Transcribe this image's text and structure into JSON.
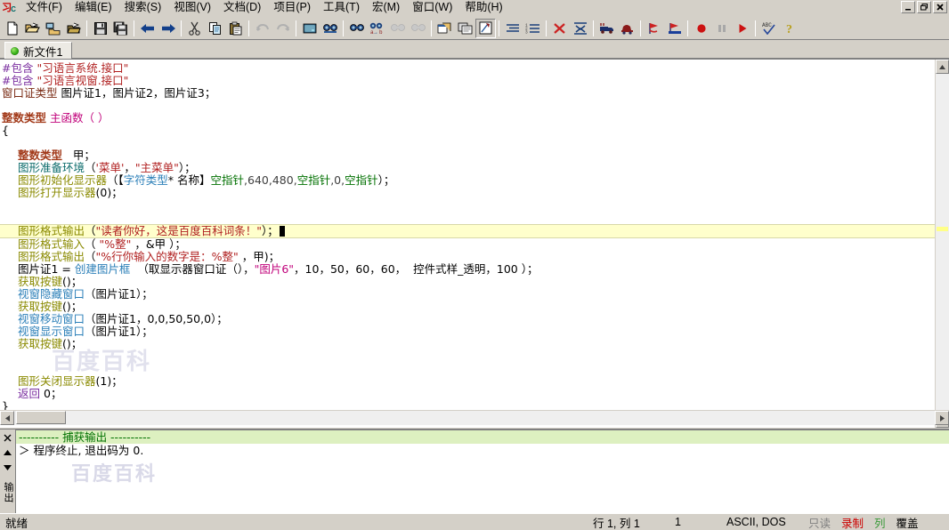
{
  "window": {
    "controls": [
      {
        "name": "minimize",
        "glyph": "minimize-icon"
      },
      {
        "name": "restore",
        "glyph": "restore-icon"
      },
      {
        "name": "close",
        "glyph": "close-icon"
      }
    ]
  },
  "menubar": {
    "app_icon": "xi-language-icon",
    "items": [
      {
        "label": "文件(F)",
        "name": "menu-file"
      },
      {
        "label": "编辑(E)",
        "name": "menu-edit"
      },
      {
        "label": "搜索(S)",
        "name": "menu-search"
      },
      {
        "label": "视图(V)",
        "name": "menu-view"
      },
      {
        "label": "文档(D)",
        "name": "menu-document"
      },
      {
        "label": "项目(P)",
        "name": "menu-project"
      },
      {
        "label": "工具(T)",
        "name": "menu-tools"
      },
      {
        "label": "宏(M)",
        "name": "menu-macro"
      },
      {
        "label": "窗口(W)",
        "name": "menu-window"
      },
      {
        "label": "帮助(H)",
        "name": "menu-help"
      }
    ]
  },
  "toolbar": {
    "buttons": [
      {
        "name": "new-file-icon",
        "enabled": true
      },
      {
        "name": "open-file-icon",
        "enabled": true
      },
      {
        "name": "open-network-file-icon",
        "enabled": true
      },
      {
        "name": "open-project-icon",
        "enabled": true
      },
      {
        "sep": true
      },
      {
        "name": "save-icon",
        "enabled": true
      },
      {
        "name": "save-all-icon",
        "enabled": true
      },
      {
        "sep": true
      },
      {
        "name": "back-arrow-icon",
        "enabled": true
      },
      {
        "name": "forward-arrow-icon",
        "enabled": true
      },
      {
        "sep": true
      },
      {
        "name": "cut-icon",
        "enabled": true
      },
      {
        "name": "copy-icon",
        "enabled": true
      },
      {
        "name": "paste-icon",
        "enabled": true
      },
      {
        "sep": true
      },
      {
        "name": "undo-icon",
        "enabled": false
      },
      {
        "name": "redo-icon",
        "enabled": false
      },
      {
        "sep": true
      },
      {
        "name": "print-preview-icon",
        "enabled": true
      },
      {
        "name": "find-icon",
        "enabled": true
      },
      {
        "sep": true
      },
      {
        "name": "find-next-icon",
        "enabled": true
      },
      {
        "name": "replace-icon",
        "enabled": true
      },
      {
        "name": "find-in-files-icon",
        "enabled": false
      },
      {
        "name": "find-previous-icon",
        "enabled": false
      },
      {
        "sep": true
      },
      {
        "name": "window-tile-icon",
        "enabled": true
      },
      {
        "name": "window-cascade-icon",
        "enabled": true
      },
      {
        "name": "run-macro-icon",
        "enabled": true,
        "pressed": true
      },
      {
        "sep": true
      },
      {
        "name": "indent-lines-icon",
        "enabled": true
      },
      {
        "name": "line-numbers-icon",
        "enabled": true
      },
      {
        "sep": true
      },
      {
        "name": "delete-icon",
        "enabled": true
      },
      {
        "name": "collapse-icon",
        "enabled": true
      },
      {
        "sep": true
      },
      {
        "name": "compile-icon",
        "enabled": true
      },
      {
        "name": "build-icon",
        "enabled": true
      },
      {
        "sep": true
      },
      {
        "name": "debug-icon",
        "enabled": true
      },
      {
        "name": "debug-run-icon",
        "enabled": true
      },
      {
        "sep": true
      },
      {
        "name": "record-icon",
        "enabled": true
      },
      {
        "name": "pause-icon",
        "enabled": false
      },
      {
        "name": "run-icon",
        "enabled": true
      },
      {
        "sep": true
      },
      {
        "name": "spell-check-icon",
        "enabled": true
      },
      {
        "name": "help-icon",
        "enabled": true
      }
    ]
  },
  "tabs": [
    {
      "label": "新文件1",
      "name": "tab-new-file-1",
      "active": true,
      "dot": "green-dot-icon"
    }
  ],
  "editor": {
    "watermark_big": "百度百科",
    "watermark_small": "百度百科",
    "lines": [
      {
        "indent": 0,
        "tokens": [
          {
            "t": "#包含 ",
            "c": "c-pre"
          },
          {
            "t": "\"习语言系统.接口\"",
            "c": "c-str"
          }
        ]
      },
      {
        "indent": 0,
        "tokens": [
          {
            "t": "#包含 ",
            "c": "c-pre"
          },
          {
            "t": "\"习语言视窗.接口\"",
            "c": "c-str"
          }
        ]
      },
      {
        "indent": 0,
        "tokens": [
          {
            "t": "窗口证类型",
            "c": "c-type"
          },
          {
            "t": " 图片证1，图片证2，图片证3；",
            "c": "c-plain"
          }
        ]
      },
      {
        "indent": 0,
        "tokens": []
      },
      {
        "indent": 0,
        "tokens": [
          {
            "t": "整数类型",
            "c": "c-kw"
          },
          {
            "t": " 主函数（ ）",
            "c": "c-pink"
          }
        ]
      },
      {
        "indent": 0,
        "tokens": [
          {
            "t": "{",
            "c": "c-plain"
          }
        ]
      },
      {
        "indent": 0,
        "tokens": []
      },
      {
        "indent": 2,
        "tokens": [
          {
            "t": "整数类型",
            "c": "c-kw"
          },
          {
            "t": "   甲；",
            "c": "c-plain"
          }
        ]
      },
      {
        "indent": 2,
        "tokens": [
          {
            "t": "图形准备环境",
            "c": "c-fn"
          },
          {
            "t": "（",
            "c": "c-plain"
          },
          {
            "t": "'菜单'",
            "c": "c-str"
          },
          {
            "t": "，",
            "c": "c-plain"
          },
          {
            "t": "\"主菜单\"",
            "c": "c-str"
          },
          {
            "t": "）；",
            "c": "c-plain"
          }
        ]
      },
      {
        "indent": 2,
        "tokens": [
          {
            "t": "图形初始化显示器",
            "c": "c-olive"
          },
          {
            "t": "（【",
            "c": "c-plain"
          },
          {
            "t": "字符类型",
            "c": "c-fn3"
          },
          {
            "t": "* 名称】",
            "c": "c-plain"
          },
          {
            "t": "空指针",
            "c": "c-green"
          },
          {
            "t": ",640,480,",
            "c": "c-num"
          },
          {
            "t": "空指针",
            "c": "c-green"
          },
          {
            "t": ",0,",
            "c": "c-num"
          },
          {
            "t": "空指针",
            "c": "c-green"
          },
          {
            "t": "）；",
            "c": "c-plain"
          }
        ]
      },
      {
        "indent": 2,
        "tokens": [
          {
            "t": "图形打开显示器",
            "c": "c-olive"
          },
          {
            "t": "(0)；",
            "c": "c-plain"
          }
        ]
      },
      {
        "indent": 0,
        "tokens": []
      },
      {
        "indent": 0,
        "tokens": []
      },
      {
        "indent": 2,
        "highlight": true,
        "tokens": [
          {
            "t": "图形格式输出",
            "c": "c-olive"
          },
          {
            "t": "（",
            "c": "c-plain"
          },
          {
            "t": "\"读者你好，这是百度百科词条！\"",
            "c": "c-str"
          },
          {
            "t": "）；",
            "c": "c-plain"
          }
        ],
        "caret": true
      },
      {
        "indent": 2,
        "tokens": [
          {
            "t": "图形格式输入",
            "c": "c-olive"
          },
          {
            "t": "（ ",
            "c": "c-plain"
          },
          {
            "t": "\"%整\"",
            "c": "c-str"
          },
          {
            "t": " ，&甲 ）；",
            "c": "c-plain"
          }
        ]
      },
      {
        "indent": 2,
        "tokens": [
          {
            "t": "图形格式输出",
            "c": "c-olive"
          },
          {
            "t": "（",
            "c": "c-plain"
          },
          {
            "t": "\"%行你输入的数字是：%整\"",
            "c": "c-str"
          },
          {
            "t": " ，甲)；",
            "c": "c-plain"
          }
        ]
      },
      {
        "indent": 2,
        "tokens": [
          {
            "t": "图片证1 = ",
            "c": "c-plain"
          },
          {
            "t": "创建图片框",
            "c": "c-fn3"
          },
          {
            "t": "  （取显示器窗口证（），",
            "c": "c-plain"
          },
          {
            "t": "\"图片6\"",
            "c": "c-pink"
          },
          {
            "t": "，10，50，60，60，  控件式样_透明，100 ）；",
            "c": "c-plain"
          }
        ]
      },
      {
        "indent": 2,
        "tokens": [
          {
            "t": "获取按键",
            "c": "c-olive"
          },
          {
            "t": "()；",
            "c": "c-plain"
          }
        ]
      },
      {
        "indent": 2,
        "tokens": [
          {
            "t": "视窗隐藏窗口",
            "c": "c-fn3"
          },
          {
            "t": "（图片证1）；",
            "c": "c-plain"
          }
        ]
      },
      {
        "indent": 2,
        "tokens": [
          {
            "t": "获取按键",
            "c": "c-olive"
          },
          {
            "t": "()；",
            "c": "c-plain"
          }
        ]
      },
      {
        "indent": 2,
        "tokens": [
          {
            "t": "视窗移动窗口",
            "c": "c-fn3"
          },
          {
            "t": "（图片证1，0,0,50,50,0）；",
            "c": "c-plain"
          }
        ]
      },
      {
        "indent": 2,
        "tokens": [
          {
            "t": "视窗显示窗口",
            "c": "c-fn3"
          },
          {
            "t": "（图片证1）；",
            "c": "c-plain"
          }
        ]
      },
      {
        "indent": 2,
        "tokens": [
          {
            "t": "获取按键",
            "c": "c-olive"
          },
          {
            "t": "()；",
            "c": "c-plain"
          }
        ]
      },
      {
        "indent": 0,
        "tokens": []
      },
      {
        "indent": 0,
        "tokens": []
      },
      {
        "indent": 2,
        "tokens": [
          {
            "t": "图形关闭显示器",
            "c": "c-olive"
          },
          {
            "t": "(1)；",
            "c": "c-plain"
          }
        ]
      },
      {
        "indent": 2,
        "tokens": [
          {
            "t": "返回",
            "c": "c-pre"
          },
          {
            "t": " 0；",
            "c": "c-plain"
          }
        ]
      },
      {
        "indent": 0,
        "tokens": [
          {
            "t": "}",
            "c": "c-plain"
          }
        ]
      }
    ]
  },
  "output": {
    "close_icon": "close-icon",
    "up_icon": "scroll-up-icon",
    "down_icon": "scroll-down-icon",
    "panel_label": "输出",
    "lines": [
      {
        "text": "---------- 捕获输出 ----------",
        "head": true
      },
      {
        "text": "＞ 程序终止, 退出码为 0.",
        "head": false
      }
    ]
  },
  "statusbar": {
    "ready": "就绪",
    "line_col": "行 1,  列 1",
    "sel": "1",
    "encoding": "ASCII, DOS",
    "readonly": "只读",
    "record": "录制",
    "column": "列",
    "overwrite": "覆盖"
  },
  "colors": {
    "chrome": "#d4d0c8",
    "editor_bg": "#ffffff",
    "highlight_line": "#ffffcc",
    "output_head_bg": "#ddf0c0",
    "output_head_fg": "#007000",
    "scroll_green": "#9fdc4f",
    "record_red": "#cc0000"
  }
}
